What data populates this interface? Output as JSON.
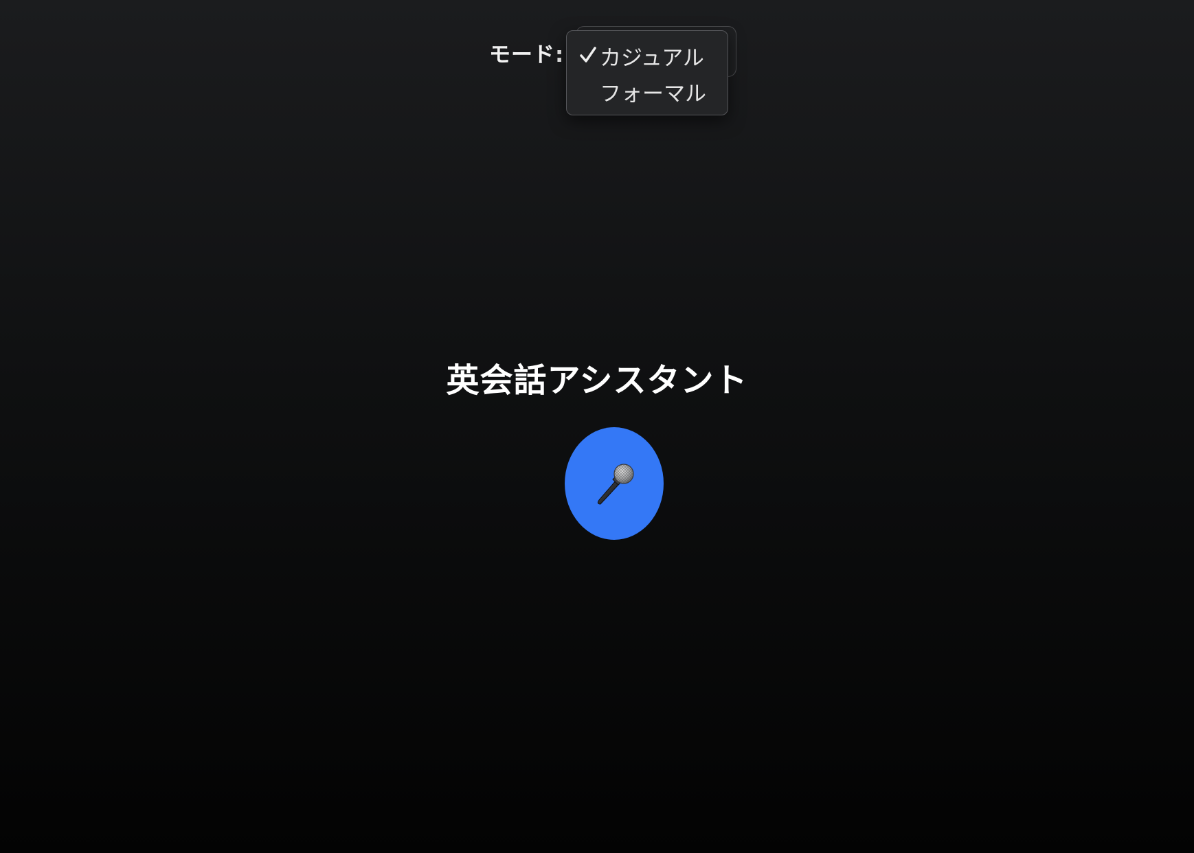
{
  "mode": {
    "label": "モード:",
    "selected": "カジュアル",
    "options": [
      "カジュアル",
      "フォーマル"
    ]
  },
  "title": "英会話アシスタント",
  "mic_button": {
    "icon": "microphone-icon",
    "color": "#3478f6"
  },
  "colors": {
    "background_top": "#1b1c1e",
    "background_bottom": "#030303",
    "accent": "#3478f6"
  }
}
